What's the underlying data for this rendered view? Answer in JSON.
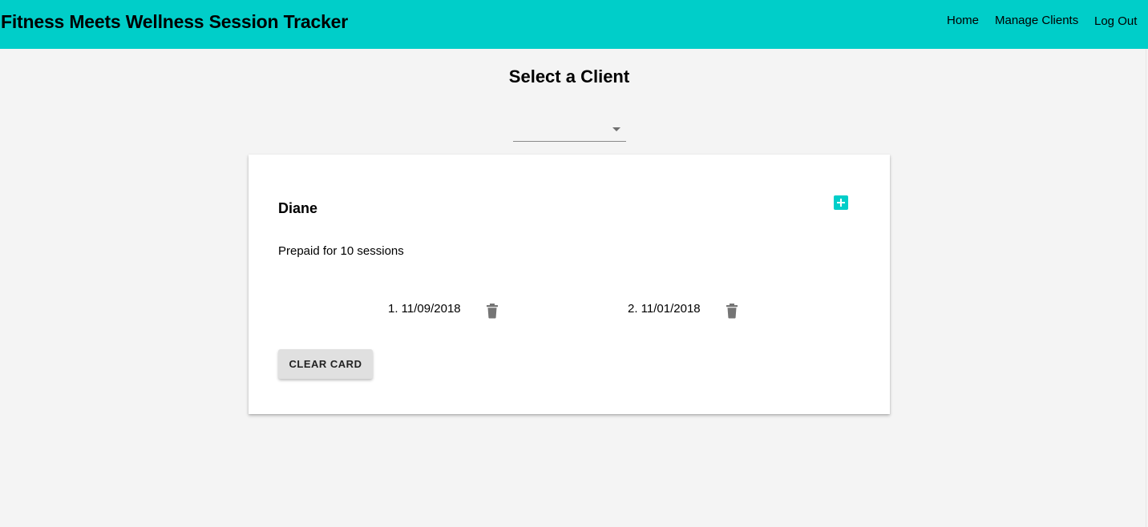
{
  "app": {
    "title": "Fitness Meets Wellness Session Tracker",
    "accent_color": "#00cec9"
  },
  "nav": {
    "home": "Home",
    "manage_clients": "Manage Clients",
    "log_out": "Log Out"
  },
  "main": {
    "heading": "Select a Client",
    "client_select": {
      "selected_value": "",
      "icon": "chevron-down-icon"
    }
  },
  "client_card": {
    "name": "Diane",
    "prepaid_text": "Prepaid for 10 sessions",
    "add_icon": "add-box-icon",
    "sessions": [
      {
        "label": "1. 11/09/2018",
        "icon": "trash-icon"
      },
      {
        "label": "2. 11/01/2018",
        "icon": "trash-icon"
      }
    ],
    "clear_button": "CLEAR CARD"
  }
}
